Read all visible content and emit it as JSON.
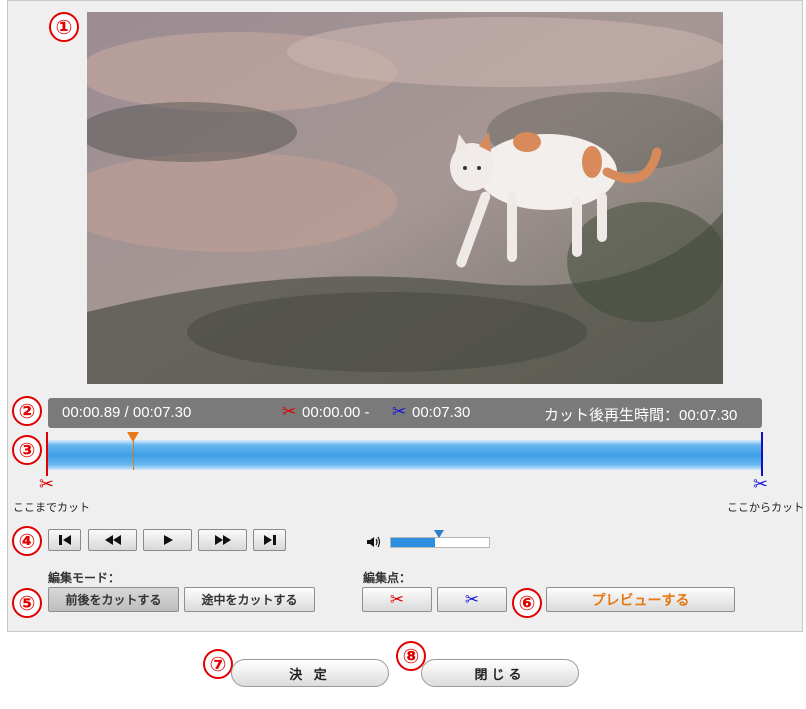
{
  "markers": [
    "①",
    "②",
    "③",
    "④",
    "⑤",
    "⑥",
    "⑦",
    "⑧"
  ],
  "info": {
    "current_total": "00:00.89 / 00:07.30",
    "cut_range": "00:00.00 - ",
    "cut_range_end": "00:07.30",
    "post_cut_label": "カット後再生時間：00:07.30"
  },
  "timeline": {
    "left_cut_label": "ここまでカット",
    "right_cut_label": "ここからカット",
    "playhead_fraction": 0.12,
    "colors": {
      "left_cut": "#e00000",
      "right_cut": "#1010c0",
      "playhead": "#e8791b"
    }
  },
  "controls": {
    "icons": [
      "skip-to-start-icon",
      "rewind-icon",
      "play-icon",
      "fast-forward-icon",
      "skip-to-end-icon"
    ],
    "volume_level": 0.45
  },
  "edit_mode": {
    "label": "編集モード：",
    "cut_before_after": "前後をカットする",
    "cut_middle": "途中をカットする"
  },
  "edit_points": {
    "label": "編集点：",
    "start_icon": "✂",
    "end_icon": "✂",
    "preview": "プレビューする"
  },
  "footer": {
    "confirm": "決 定",
    "close": "閉じる"
  }
}
